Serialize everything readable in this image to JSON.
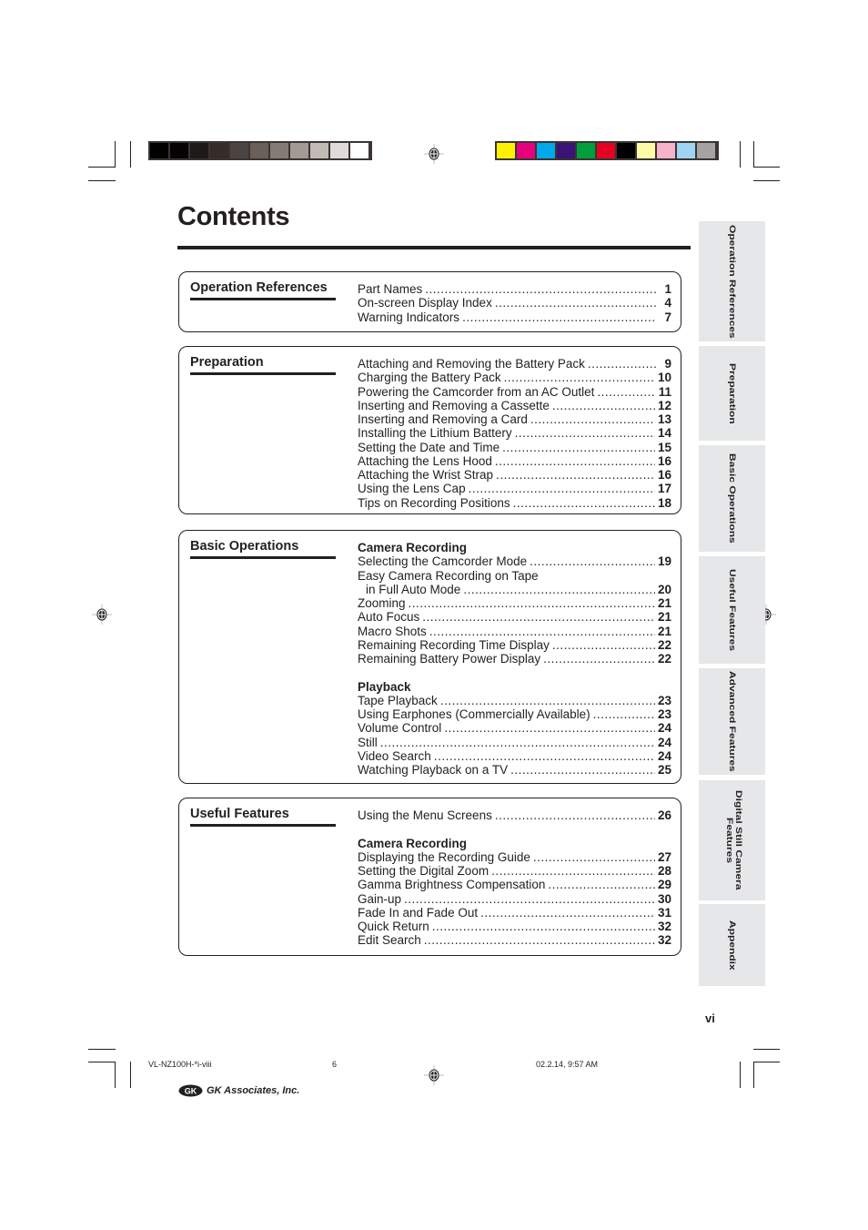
{
  "title": "Contents",
  "page_number": "vi",
  "gray_swatches": [
    "#000000",
    "#050203",
    "#1e1a17",
    "#352c28",
    "#4b4440",
    "#6a6058",
    "#857b75",
    "#a39a94",
    "#c2bab5",
    "#e0dbd8",
    "#ffffff"
  ],
  "color_swatches": [
    "#fff200",
    "#e6007e",
    "#00a9e8",
    "#3a1377",
    "#009e3c",
    "#e60023",
    "#000000",
    "#fffaa8",
    "#f7b2cc",
    "#9fd4f3",
    "#a3a3a3"
  ],
  "sections": [
    {
      "title": "Operation References",
      "entries": [
        {
          "text": "Part Names",
          "page": "1"
        },
        {
          "text": "On-screen Display Index",
          "page": "4"
        },
        {
          "text": "Warning Indicators",
          "page": "7"
        }
      ]
    },
    {
      "title": "Preparation",
      "entries": [
        {
          "text": "Attaching and Removing the Battery Pack",
          "page": "9"
        },
        {
          "text": "Charging the Battery Pack",
          "page": "10"
        },
        {
          "text": "Powering the Camcorder from an AC Outlet",
          "page": "11"
        },
        {
          "text": "Inserting and Removing a Cassette",
          "page": "12"
        },
        {
          "text": "Inserting and Removing a Card",
          "page": "13"
        },
        {
          "text": "Installing the Lithium Battery",
          "page": "14"
        },
        {
          "text": "Setting the Date and Time",
          "page": "15"
        },
        {
          "text": "Attaching the Lens Hood",
          "page": "16"
        },
        {
          "text": "Attaching the Wrist Strap",
          "page": "16"
        },
        {
          "text": "Using the Lens Cap",
          "page": "17"
        },
        {
          "text": "Tips on Recording Positions",
          "page": "18"
        }
      ]
    },
    {
      "title": "Basic Operations",
      "entries": [
        {
          "text": "Camera Recording",
          "heading": true
        },
        {
          "text": "Selecting the Camcorder Mode",
          "page": "19"
        },
        {
          "text": "Easy Camera Recording on Tape",
          "nodots": true
        },
        {
          "text": "in Full Auto Mode",
          "page": "20",
          "indent": true
        },
        {
          "text": "Zooming",
          "page": "21"
        },
        {
          "text": "Auto Focus",
          "page": "21"
        },
        {
          "text": "Macro Shots",
          "page": "21"
        },
        {
          "text": "Remaining Recording Time Display",
          "page": "22"
        },
        {
          "text": "Remaining Battery Power Display",
          "page": "22"
        },
        {
          "blank": true
        },
        {
          "text": "Playback",
          "heading": true
        },
        {
          "text": "Tape Playback",
          "page": "23"
        },
        {
          "text": "Using Earphones (Commercially Available)",
          "page": "23"
        },
        {
          "text": "Volume Control",
          "page": "24"
        },
        {
          "text": "Still",
          "page": "24"
        },
        {
          "text": "Video Search",
          "page": "24"
        },
        {
          "text": "Watching Playback on a TV",
          "page": "25"
        }
      ]
    },
    {
      "title": "Useful Features",
      "entries": [
        {
          "text": "Using the Menu Screens",
          "page": "26"
        },
        {
          "blank": true
        },
        {
          "text": "Camera Recording",
          "heading": true
        },
        {
          "text": "Displaying the Recording Guide",
          "page": "27"
        },
        {
          "text": "Setting the Digital Zoom",
          "page": "28"
        },
        {
          "text": "Gamma Brightness Compensation",
          "page": "29"
        },
        {
          "text": "Gain-up",
          "page": "30"
        },
        {
          "text": "Fade In and Fade Out",
          "page": "31"
        },
        {
          "text": "Quick Return",
          "page": "32"
        },
        {
          "text": "Edit Search",
          "page": "32"
        }
      ]
    }
  ],
  "side_tabs": [
    "Operation References",
    "Preparation",
    "Basic Operations",
    "Useful Features",
    "Advanced Features",
    "Digital Still Camera Features",
    "Appendix"
  ],
  "footer": {
    "file": "VL-NZ100H-*i-viii",
    "sheet": "6",
    "timestamp": "02.2.14, 9:57 AM",
    "logo_text": "GK Associates, Inc."
  }
}
